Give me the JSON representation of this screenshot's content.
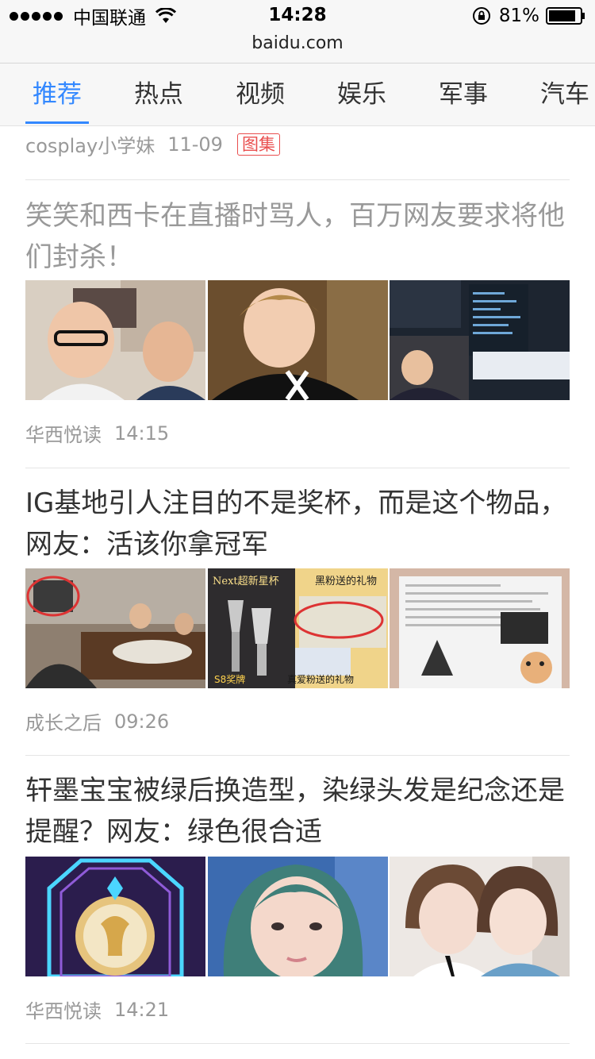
{
  "status_bar": {
    "carrier": "中国联通",
    "time": "14:28",
    "battery": "81%"
  },
  "address_bar": {
    "url": "baidu.com"
  },
  "tabs": [
    "推荐",
    "热点",
    "视频",
    "娱乐",
    "军事",
    "汽车"
  ],
  "active_tab": 0,
  "feed": {
    "top_item": {
      "source": "cosplay小学妹",
      "time": "11-09",
      "tag": "图集"
    },
    "items": [
      {
        "title": "笑笑和西卡在直播时骂人，百万网友要求将他们封杀！",
        "source": "华西悦读",
        "time": "14:15",
        "read": true
      },
      {
        "title": "IG基地引人注目的不是奖杯，而是这个物品，网友：活该你拿冠军",
        "source": "成长之后",
        "time": "09:26",
        "read": false
      },
      {
        "title": "轩墨宝宝被绿后换造型，染绿头发是纪念还是提醒？网友：绿色很合适",
        "source": "华西悦读",
        "time": "14:21",
        "read": false
      }
    ]
  },
  "image_captions": {
    "trophy_label": "Next超新星杯",
    "gift_label": "黑粉送的礼物",
    "s8_label": "S8奖牌",
    "true_fan_label": "真爱粉送的礼物"
  }
}
